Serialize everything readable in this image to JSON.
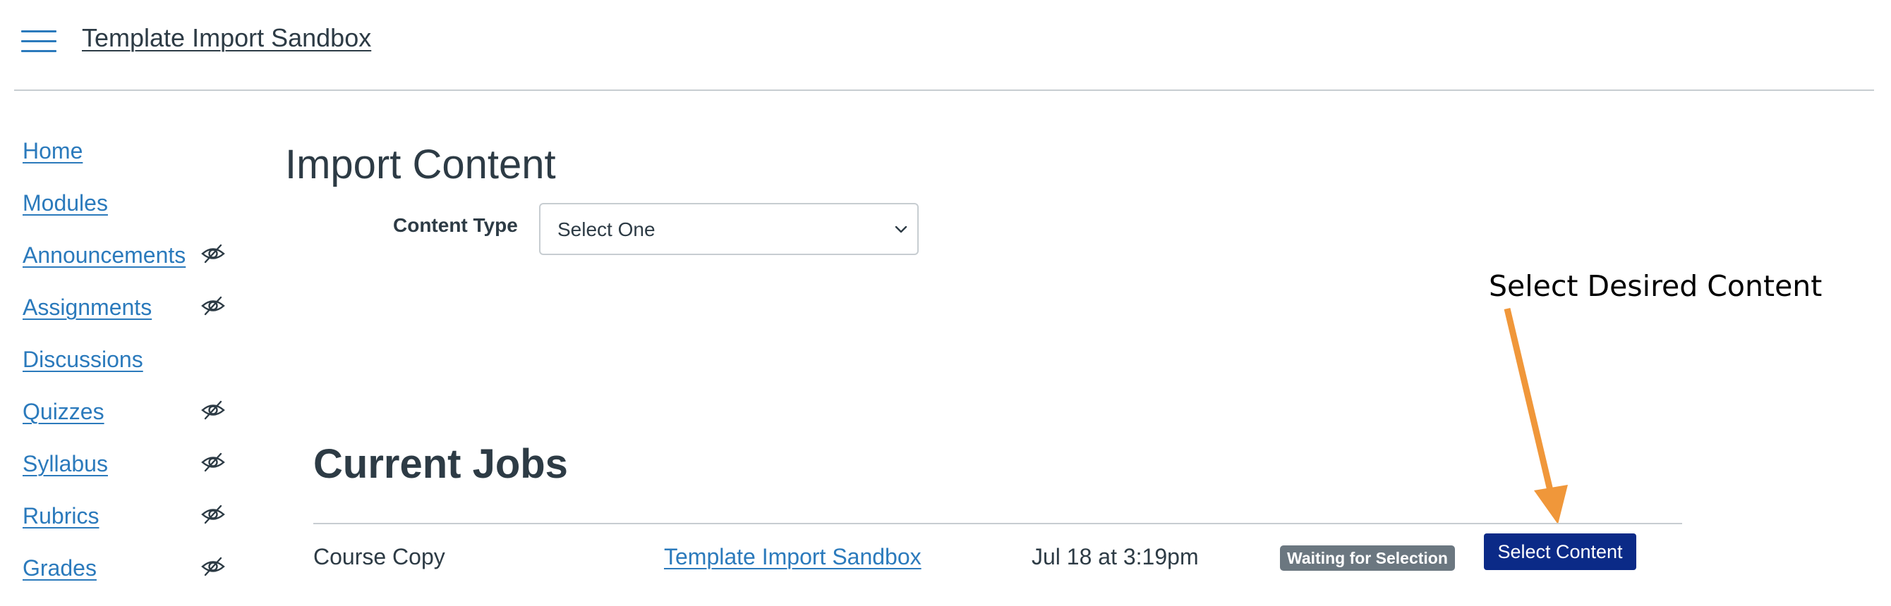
{
  "header": {
    "course_title": "Template Import Sandbox"
  },
  "sidebar": {
    "items": [
      {
        "label": "Home",
        "hidden_icon": false
      },
      {
        "label": "Modules",
        "hidden_icon": false
      },
      {
        "label": "Announcements",
        "hidden_icon": true
      },
      {
        "label": "Assignments",
        "hidden_icon": true
      },
      {
        "label": "Discussions",
        "hidden_icon": false
      },
      {
        "label": "Quizzes",
        "hidden_icon": true
      },
      {
        "label": "Syllabus",
        "hidden_icon": true
      },
      {
        "label": "Rubrics",
        "hidden_icon": true
      },
      {
        "label": "Grades",
        "hidden_icon": true
      }
    ]
  },
  "main": {
    "page_title": "Import Content",
    "content_type": {
      "label": "Content Type",
      "selected": "Select One"
    },
    "annotation": "Select Desired Content",
    "current_jobs": {
      "title": "Current Jobs",
      "rows": [
        {
          "type": "Course Copy",
          "source": "Template Import Sandbox",
          "date": "Jul 18 at 3:19pm",
          "status": "Waiting for Selection",
          "action_label": "Select Content"
        }
      ]
    }
  },
  "colors": {
    "link": "#2b7abc",
    "text": "#2d3b45",
    "primary_button": "#0b2a87",
    "status_badge": "#6b7780",
    "annotation_arrow": "#f0973a"
  }
}
